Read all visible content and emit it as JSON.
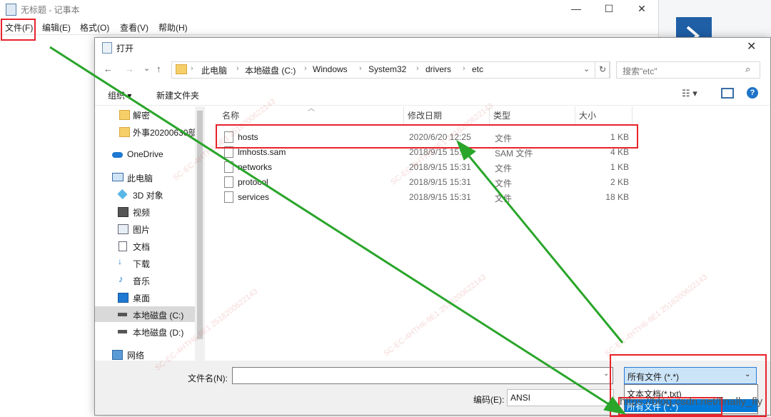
{
  "notepad": {
    "title": "无标题 - 记事本",
    "window_controls": [
      "—",
      "☐",
      "✕"
    ],
    "menu": [
      "文件(F)",
      "编辑(E)",
      "格式(O)",
      "查看(V)",
      "帮助(H)"
    ]
  },
  "dialog": {
    "title": "打开",
    "close": "✕",
    "nav": {
      "back": "←",
      "forward": "→",
      "recent": "⌄",
      "up": "↑"
    },
    "breadcrumb": [
      "此电脑",
      "本地磁盘 (C:)",
      "Windows",
      "System32",
      "drivers",
      "etc"
    ],
    "breadcrumb_sep": "›",
    "dropdown_arrow": "⌄",
    "refresh": "↻",
    "search_placeholder": "搜索\"etc\"",
    "search_icon": "⌕",
    "toolbar": {
      "organize": "组织 ▾",
      "new_folder": "新建文件夹",
      "view": "☷ ▾",
      "help": "?"
    },
    "sidebar": [
      {
        "label": "解密",
        "icon": "folder-icon"
      },
      {
        "label": "外事20200630部",
        "icon": "folder-icon"
      },
      {
        "label": "OneDrive",
        "icon": "cloud-icon"
      },
      {
        "label": "此电脑",
        "icon": "computer-icon"
      },
      {
        "label": "3D 对象",
        "icon": "cube-icon"
      },
      {
        "label": "视频",
        "icon": "video-icon"
      },
      {
        "label": "图片",
        "icon": "picture-icon"
      },
      {
        "label": "文档",
        "icon": "document-icon"
      },
      {
        "label": "下载",
        "icon": "download-icon"
      },
      {
        "label": "音乐",
        "icon": "music-icon"
      },
      {
        "label": "桌面",
        "icon": "desktop-icon"
      },
      {
        "label": "本地磁盘 (C:)",
        "icon": "drive-icon",
        "selected": true
      },
      {
        "label": "本地磁盘 (D:)",
        "icon": "drive-icon"
      },
      {
        "label": "网络",
        "icon": "network-icon"
      }
    ],
    "columns": [
      "名称",
      "修改日期",
      "类型",
      "大小"
    ],
    "files": [
      {
        "name": "hosts",
        "date": "2020/6/20 12:25",
        "type": "文件",
        "size": "1 KB"
      },
      {
        "name": "lmhosts.sam",
        "date": "2018/9/15 15:31",
        "type": "SAM 文件",
        "size": "4 KB"
      },
      {
        "name": "networks",
        "date": "2018/9/15 15:31",
        "type": "文件",
        "size": "1 KB"
      },
      {
        "name": "protocol",
        "date": "2018/9/15 15:31",
        "type": "文件",
        "size": "2 KB"
      },
      {
        "name": "services",
        "date": "2018/9/15 15:31",
        "type": "文件",
        "size": "18 KB"
      }
    ],
    "filename_label": "文件名(N):",
    "filename_value": "",
    "filetype_selected": "所有文件  (*.*)",
    "filetype_options": [
      "文本文档(*.txt)",
      "所有文件  (*.*)"
    ],
    "encoding_label": "编码(E):",
    "encoding_value": "ANSI"
  },
  "watermark": "https://blog.csdn.net/finally_fly",
  "stamp": "SC-EC-4HTH6-9E1 2518200622143",
  "colors": {
    "annotation_red": "#e8222b",
    "arrow_green": "#2aa52a",
    "select_blue": "#0078d7"
  }
}
